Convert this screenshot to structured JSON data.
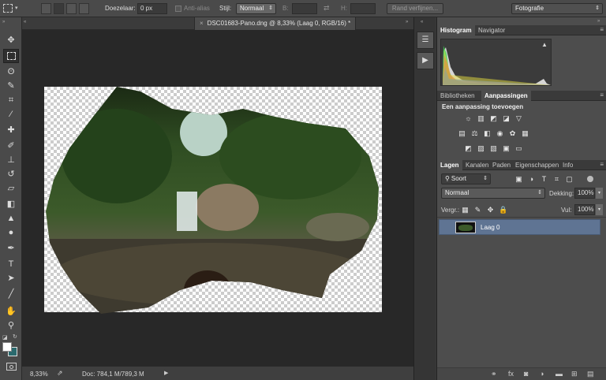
{
  "options_bar": {
    "feather_label": "Doezelaar:",
    "feather_value": "0 px",
    "antialias_label": "Anti-alias",
    "style_label": "Stijl:",
    "style_value": "Normaal",
    "width_label": "B:",
    "height_label": "H:",
    "refine_edge_label": "Rand verfijnen...",
    "workspace_value": "Fotografie"
  },
  "document": {
    "tab_title": "DSC01683-Pano.dng @ 8,33% (Laag 0, RGB/16) *",
    "zoom": "8,33%",
    "doc_info": "Doc: 784,1 M/789,3 M"
  },
  "panels": {
    "top_tabs": [
      "Histogram",
      "Navigator"
    ],
    "warning_icon": "!",
    "adjust_tabs": [
      "Bibliotheken",
      "Aanpassingen"
    ],
    "adjust_heading": "Een aanpassing toevoegen",
    "layer_tabs": [
      "Lagen",
      "Kanalen",
      "Paden",
      "Eigenschappen",
      "Info"
    ],
    "filter_kind": "Soort",
    "blend_mode": "Normaal",
    "opacity_label": "Dekking:",
    "opacity_value": "100%",
    "lock_label": "Vergr.:",
    "fill_label": "Vul:",
    "fill_value": "100%",
    "layer_name": "Laag 0"
  },
  "colors": {
    "accent_selected_row": "#5f7493",
    "panel_bg": "#4d4d4d",
    "canvas_bg": "#282828"
  }
}
